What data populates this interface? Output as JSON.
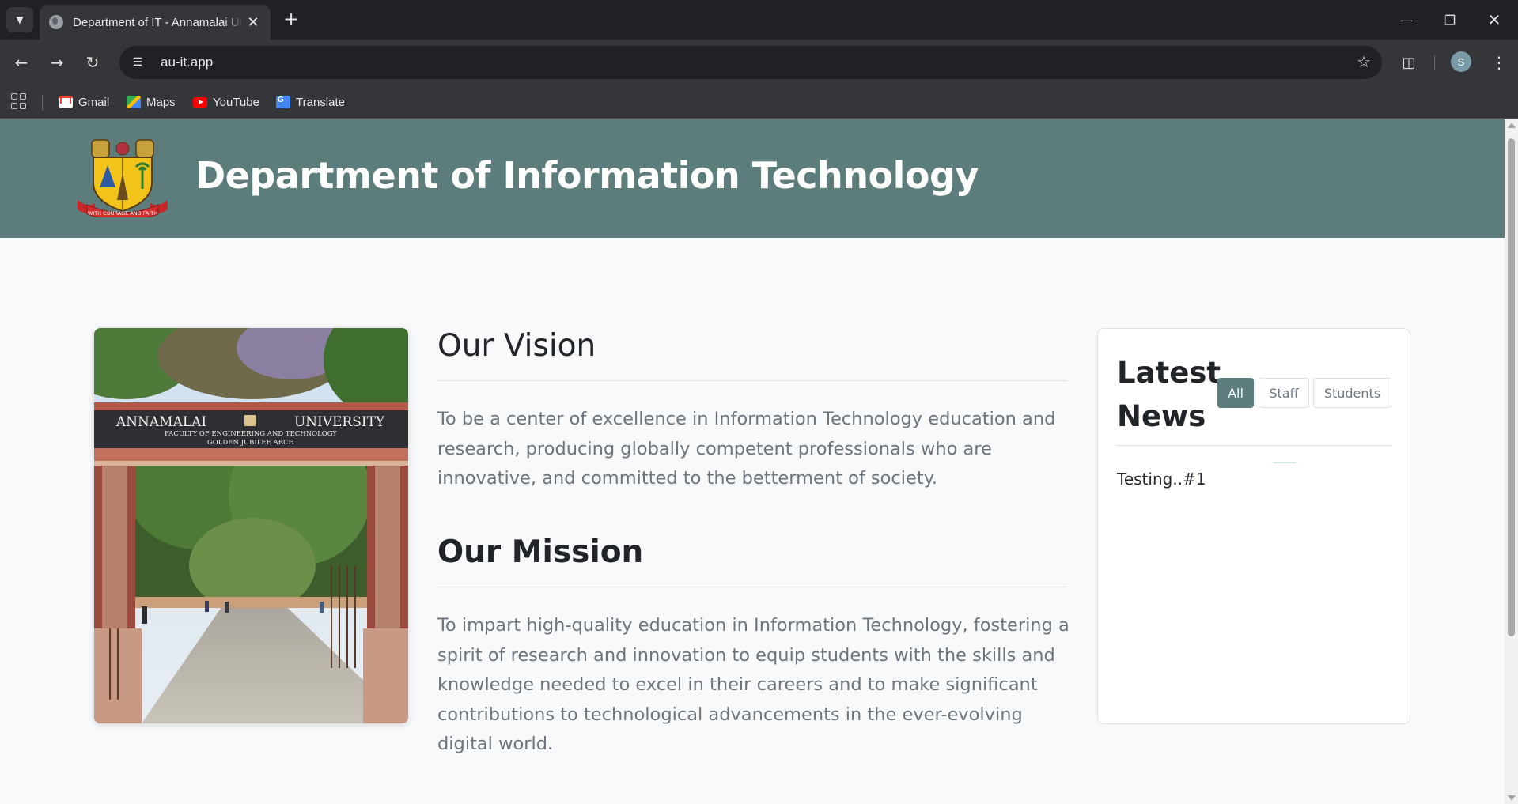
{
  "browser": {
    "tab_title": "Department of IT - Annamalai University",
    "url": "au-it.app",
    "profile_initial": "S",
    "bookmarks": [
      {
        "label": "Gmail",
        "icon": "gmail-icon"
      },
      {
        "label": "Maps",
        "icon": "maps-icon"
      },
      {
        "label": "YouTube",
        "icon": "youtube-icon"
      },
      {
        "label": "Translate",
        "icon": "translate-icon"
      }
    ]
  },
  "header": {
    "title": "Department of Information Technology",
    "logo_text": "WITH COURAGE AND FAITH",
    "background": "#5c7d7c"
  },
  "photo": {
    "sign_title_left": "ANNAMALAI",
    "sign_title_right": "UNIVERSITY",
    "sign_line_2": "FACULTY OF ENGINEERING AND TECHNOLOGY",
    "sign_line_3": "GOLDEN JUBILEE ARCH"
  },
  "vision": {
    "title": "Our Vision",
    "text": "To be a center of excellence in Information Technology education and research, producing globally competent professionals who are innovative, and committed to the betterment of society."
  },
  "mission": {
    "title": "Our Mission",
    "text": "To impart high-quality education in Information Technology, fostering a spirit of research and innovation to equip students with the skills and knowledge needed to excel in their careers and to make significant contributions to technological advancements in the ever-evolving digital world."
  },
  "news": {
    "title": "Latest News",
    "filters": {
      "all": "All",
      "staff": "Staff",
      "students": "Students"
    },
    "active_filter": "All",
    "items": [
      "Testing..#1"
    ]
  }
}
